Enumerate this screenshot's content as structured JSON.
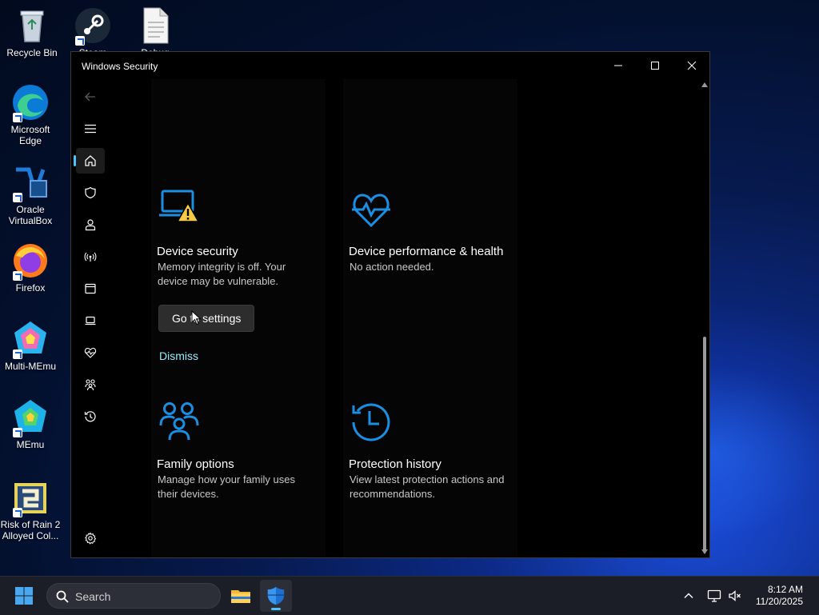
{
  "desktop": {
    "icons": [
      {
        "label": "Recycle Bin",
        "icon": "recycle-bin-icon"
      },
      {
        "label": "Steam",
        "icon": "steam-icon"
      },
      {
        "label": "Debug",
        "icon": "text-file-icon"
      },
      {
        "label": "Microsoft Edge",
        "icon": "edge-icon"
      },
      {
        "label": "Oracle VirtualBox",
        "icon": "virtualbox-icon"
      },
      {
        "label": "Firefox",
        "icon": "firefox-icon"
      },
      {
        "label": "Multi-MEmu",
        "icon": "multi-memu-icon"
      },
      {
        "label": "MEmu",
        "icon": "memu-icon"
      },
      {
        "label": "Risk of Rain 2 Alloyed Col...",
        "icon": "game-icon"
      }
    ]
  },
  "window": {
    "title": "Windows Security",
    "controls": [
      "minimize",
      "maximize",
      "close"
    ]
  },
  "nav": {
    "items": [
      {
        "name": "back",
        "icon": "back-arrow-icon"
      },
      {
        "name": "menu",
        "icon": "hamburger-icon"
      },
      {
        "name": "home",
        "icon": "home-icon",
        "active": true
      },
      {
        "name": "virus-protection",
        "icon": "shield-icon"
      },
      {
        "name": "account-protection",
        "icon": "person-icon"
      },
      {
        "name": "firewall-network",
        "icon": "antenna-icon"
      },
      {
        "name": "app-browser-control",
        "icon": "browser-window-icon"
      },
      {
        "name": "device-security",
        "icon": "laptop-icon"
      },
      {
        "name": "device-performance",
        "icon": "heart-pulse-icon"
      },
      {
        "name": "family-options",
        "icon": "family-icon"
      },
      {
        "name": "protection-history",
        "icon": "history-icon"
      },
      {
        "name": "settings",
        "icon": "gear-icon"
      }
    ]
  },
  "cards": {
    "device_security": {
      "title": "Device security",
      "desc": "Memory integrity is off. Your device may be vulnerable.",
      "button": "Go to settings",
      "link": "Dismiss",
      "icon": "laptop-warning-icon"
    },
    "device_performance": {
      "title": "Device performance & health",
      "desc": "No action needed.",
      "icon": "heart-pulse-icon"
    },
    "family_options": {
      "title": "Family options",
      "desc": "Manage how your family uses their devices.",
      "icon": "family-icon"
    },
    "protection_history": {
      "title": "Protection history",
      "desc": "View latest protection actions and recommendations.",
      "icon": "history-icon"
    }
  },
  "taskbar": {
    "search_placeholder": "Search",
    "time": "8:12 AM",
    "date": "11/20/2025",
    "apps": [
      "file-explorer-icon",
      "windows-security-icon"
    ]
  },
  "colors": {
    "accent": "#4cc2ff",
    "icon_blue": "#1a8fe3",
    "warning": "#f7c948",
    "link": "#99ebff"
  }
}
